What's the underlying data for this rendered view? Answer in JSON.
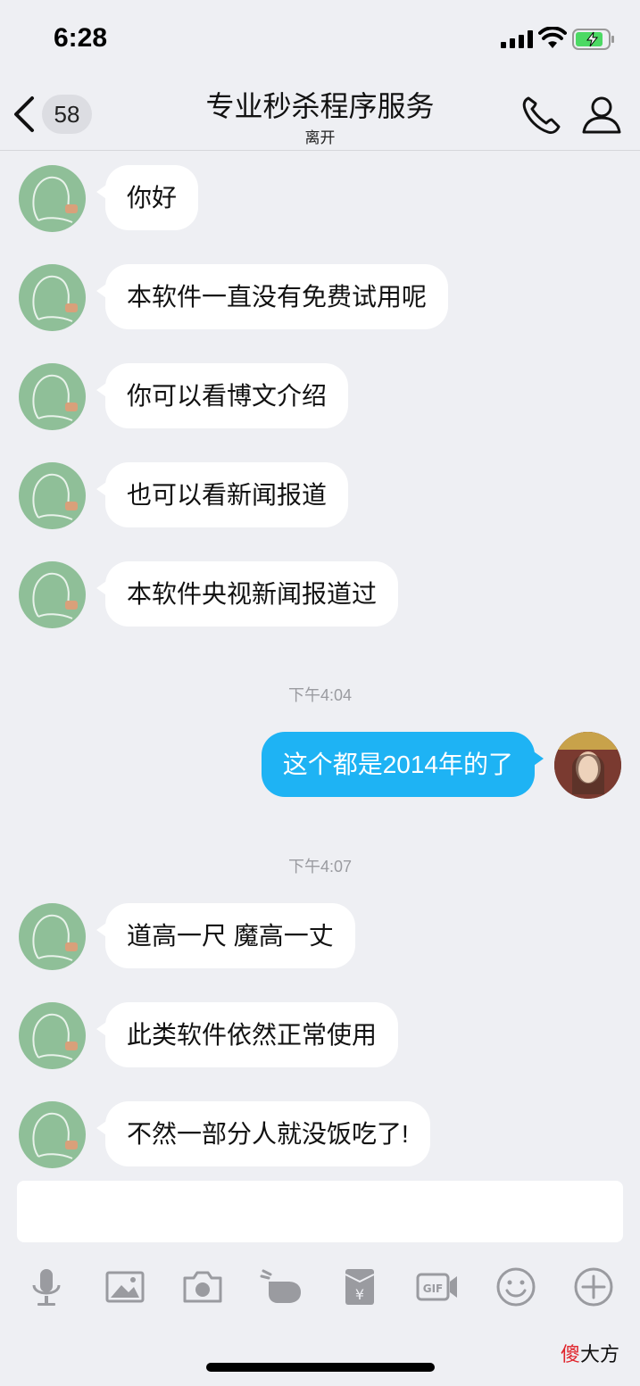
{
  "status_bar": {
    "time": "6:28"
  },
  "nav": {
    "unread_count": "58",
    "title": "专业秒杀程序服务",
    "subtitle": "离开"
  },
  "messages": [
    {
      "text": "你好"
    },
    {
      "text": "本软件一直没有免费试用呢"
    },
    {
      "text": "你可以看博文介绍"
    },
    {
      "text": "也可以看新闻报道"
    },
    {
      "text": "本软件央视新闻报道过"
    },
    {
      "timestamp": "下午4:04"
    },
    {
      "text": "这个都是2014年的了",
      "from_me": true
    },
    {
      "timestamp": "下午4:07"
    },
    {
      "text": "道高一尺 魔高一丈"
    },
    {
      "text": "此类软件依然正常使用"
    },
    {
      "text": "不然一部分人就没饭吃了!"
    }
  ],
  "input": {
    "value": "",
    "placeholder": ""
  },
  "toolbar": [
    "mic-icon",
    "image-icon",
    "camera-icon",
    "poke-icon",
    "red-packet-icon",
    "gif-icon",
    "emoji-icon",
    "plus-icon"
  ],
  "watermark": {
    "part1": "傻",
    "part2": "大方"
  },
  "colors": {
    "background": "#eeeff3",
    "my_bubble": "#1eb3f4",
    "their_bubble": "#ffffff"
  }
}
